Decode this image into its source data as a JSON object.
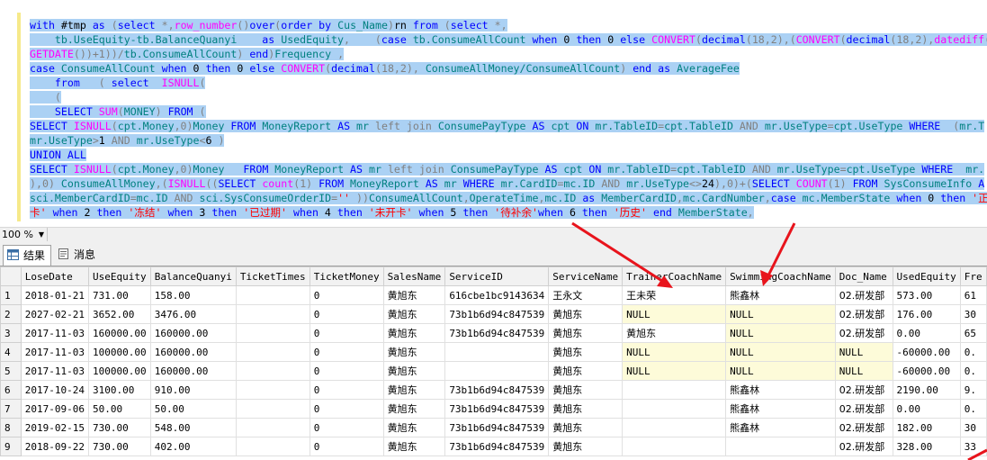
{
  "editor": {
    "lines": [
      [
        [
          "kw",
          "with "
        ],
        [
          "tx",
          "#tmp "
        ],
        [
          "kw",
          "as "
        ],
        [
          "gr",
          "("
        ],
        [
          "kw",
          "select "
        ],
        [
          "gr",
          "*,"
        ],
        [
          "fn",
          "row_number"
        ],
        [
          "gr",
          "()"
        ],
        [
          "kw",
          "over"
        ],
        [
          "gr",
          "("
        ],
        [
          "kw",
          "order by "
        ],
        [
          "tl",
          "Cus_Name"
        ],
        [
          "gr",
          ")"
        ],
        [
          "tx",
          "rn "
        ],
        [
          "kw",
          "from "
        ],
        [
          "gr",
          "("
        ],
        [
          "kw",
          "select "
        ],
        [
          "gr",
          "*,"
        ]
      ],
      [
        [
          "tx",
          "    "
        ],
        [
          "tl",
          "tb.UseEquity-tb.BalanceQuanyi    "
        ],
        [
          "kw",
          "as "
        ],
        [
          "tl",
          "UsedEquity"
        ],
        [
          "gr",
          ",    ("
        ],
        [
          "kw",
          "case "
        ],
        [
          "tl",
          "tb.ConsumeAllCount "
        ],
        [
          "kw",
          "when "
        ],
        [
          "tx",
          "0 "
        ],
        [
          "kw",
          "then "
        ],
        [
          "tx",
          "0 "
        ],
        [
          "kw",
          "else "
        ],
        [
          "fn",
          "CONVERT"
        ],
        [
          "gr",
          "("
        ],
        [
          "kw",
          "decimal"
        ],
        [
          "gr",
          "(18,2),("
        ],
        [
          "fn",
          "CONVERT"
        ],
        [
          "gr",
          "("
        ],
        [
          "kw",
          "decimal"
        ],
        [
          "gr",
          "(18,2),"
        ],
        [
          "fn",
          "datediff"
        ],
        [
          "gr",
          "(d"
        ]
      ],
      [
        [
          "fn",
          "GETDATE"
        ],
        [
          "gr",
          "())+1))/"
        ],
        [
          "tl",
          "tb.ConsumeAllCount"
        ],
        [
          "gr",
          ") "
        ],
        [
          "kw",
          "end"
        ],
        [
          "gr",
          ")"
        ],
        [
          "tl",
          "Frequency "
        ],
        [
          "gr",
          ","
        ]
      ],
      [
        [
          "kw",
          "case "
        ],
        [
          "tl",
          "ConsumeAllCount "
        ],
        [
          "kw",
          "when "
        ],
        [
          "tx",
          "0 "
        ],
        [
          "kw",
          "then "
        ],
        [
          "tx",
          "0 "
        ],
        [
          "kw",
          "else "
        ],
        [
          "fn",
          "CONVERT"
        ],
        [
          "gr",
          "("
        ],
        [
          "kw",
          "decimal"
        ],
        [
          "gr",
          "(18,2), "
        ],
        [
          "tl",
          "ConsumeAllMoney/ConsumeAllCount"
        ],
        [
          "gr",
          ") "
        ],
        [
          "kw",
          "end "
        ],
        [
          "kw",
          "as "
        ],
        [
          "tl",
          "AverageFee"
        ]
      ],
      [
        [
          "tx",
          "    "
        ],
        [
          "kw",
          "from   "
        ],
        [
          "gr",
          "( "
        ],
        [
          "kw",
          "select  "
        ],
        [
          "fn",
          "ISNULL"
        ],
        [
          "gr",
          "("
        ]
      ],
      [
        [
          "tx",
          "    "
        ],
        [
          "gr",
          "("
        ]
      ],
      [
        [
          "tx",
          "    "
        ],
        [
          "kw",
          "SELECT "
        ],
        [
          "fn",
          "SUM"
        ],
        [
          "gr",
          "("
        ],
        [
          "tl",
          "MONEY"
        ],
        [
          "gr",
          ") "
        ],
        [
          "kw",
          "FROM "
        ],
        [
          "gr",
          "("
        ]
      ],
      [
        [
          "kw",
          "SELECT "
        ],
        [
          "fn",
          "ISNULL"
        ],
        [
          "gr",
          "("
        ],
        [
          "tl",
          "cpt.Money"
        ],
        [
          "gr",
          ",0)"
        ],
        [
          "tl",
          "Money "
        ],
        [
          "kw",
          "FROM "
        ],
        [
          "tl",
          "MoneyReport "
        ],
        [
          "kw",
          "AS "
        ],
        [
          "tl",
          "mr "
        ],
        [
          "gr",
          "left join "
        ],
        [
          "tl",
          "ConsumePayType "
        ],
        [
          "kw",
          "AS "
        ],
        [
          "tl",
          "cpt "
        ],
        [
          "kw",
          "ON "
        ],
        [
          "tl",
          "mr.TableID"
        ],
        [
          "gr",
          "="
        ],
        [
          "tl",
          "cpt.TableID "
        ],
        [
          "gr",
          "AND "
        ],
        [
          "tl",
          "mr.UseType"
        ],
        [
          "gr",
          "="
        ],
        [
          "tl",
          "cpt.UseType "
        ],
        [
          "kw",
          "WHERE  "
        ],
        [
          "gr",
          "("
        ],
        [
          "tl",
          "mr.T"
        ]
      ],
      [
        [
          "tl",
          "mr.UseType"
        ],
        [
          "gr",
          ">"
        ],
        [
          "tx",
          "1 "
        ],
        [
          "gr",
          "AND "
        ],
        [
          "tl",
          "mr.UseType"
        ],
        [
          "gr",
          "<"
        ],
        [
          "tx",
          "6 "
        ],
        [
          "gr",
          ")"
        ]
      ],
      [
        [
          "kw",
          "UNION ALL"
        ]
      ],
      [
        [
          "kw",
          "SELECT "
        ],
        [
          "fn",
          "ISNULL"
        ],
        [
          "gr",
          "("
        ],
        [
          "tl",
          "cpt.Money"
        ],
        [
          "gr",
          ",0)"
        ],
        [
          "tl",
          "Money   "
        ],
        [
          "kw",
          "FROM "
        ],
        [
          "tl",
          "MoneyReport "
        ],
        [
          "kw",
          "AS "
        ],
        [
          "tl",
          "mr "
        ],
        [
          "gr",
          "left join "
        ],
        [
          "tl",
          "ConsumePayType "
        ],
        [
          "kw",
          "AS "
        ],
        [
          "tl",
          "cpt "
        ],
        [
          "kw",
          "ON "
        ],
        [
          "tl",
          "mr.TableID"
        ],
        [
          "gr",
          "="
        ],
        [
          "tl",
          "cpt.TableID "
        ],
        [
          "gr",
          "AND "
        ],
        [
          "tl",
          "mr.UseType"
        ],
        [
          "gr",
          "="
        ],
        [
          "tl",
          "cpt.UseType "
        ],
        [
          "kw",
          "WHERE  "
        ],
        [
          "tl",
          "mr."
        ]
      ],
      [
        [
          "gr",
          "),0) "
        ],
        [
          "tl",
          "ConsumeAllMoney"
        ],
        [
          "gr",
          ",("
        ],
        [
          "fn",
          "ISNULL"
        ],
        [
          "gr",
          "(("
        ],
        [
          "kw",
          "SELECT "
        ],
        [
          "fn",
          "count"
        ],
        [
          "gr",
          "(1) "
        ],
        [
          "kw",
          "FROM "
        ],
        [
          "tl",
          "MoneyReport "
        ],
        [
          "kw",
          "AS "
        ],
        [
          "tl",
          "mr "
        ],
        [
          "kw",
          "WHERE "
        ],
        [
          "tl",
          "mr.CardID"
        ],
        [
          "gr",
          "="
        ],
        [
          "tl",
          "mc.ID "
        ],
        [
          "gr",
          "AND "
        ],
        [
          "tl",
          "mr.UseType"
        ],
        [
          "gr",
          "<>"
        ],
        [
          "tx",
          "24"
        ],
        [
          "gr",
          "),0)+("
        ],
        [
          "kw",
          "SELECT "
        ],
        [
          "fn",
          "COUNT"
        ],
        [
          "gr",
          "(1) "
        ],
        [
          "kw",
          "FROM "
        ],
        [
          "tl",
          "SysConsumeInfo "
        ],
        [
          "kw",
          "A"
        ]
      ],
      [
        [
          "tl",
          "sci.MemberCardID"
        ],
        [
          "gr",
          "="
        ],
        [
          "tl",
          "mc.ID "
        ],
        [
          "gr",
          "AND "
        ],
        [
          "tl",
          "sci.SysConsumeOrderID"
        ],
        [
          "gr",
          "="
        ],
        [
          "st",
          "'' "
        ],
        [
          "gr",
          "))"
        ],
        [
          "tl",
          "ConsumeAllCount"
        ],
        [
          "gr",
          ","
        ],
        [
          "tl",
          "OperateTime"
        ],
        [
          "gr",
          ","
        ],
        [
          "tl",
          "mc.ID "
        ],
        [
          "kw",
          "as "
        ],
        [
          "tl",
          "MemberCardID"
        ],
        [
          "gr",
          ","
        ],
        [
          "tl",
          "mc.CardNumber"
        ],
        [
          "gr",
          ","
        ],
        [
          "kw",
          "case "
        ],
        [
          "tl",
          "mc.MemberState "
        ],
        [
          "kw",
          "when "
        ],
        [
          "tx",
          "0 "
        ],
        [
          "kw",
          "then "
        ],
        [
          "st",
          "'正"
        ]
      ],
      [
        [
          "st",
          "卡' "
        ],
        [
          "kw",
          "when "
        ],
        [
          "tx",
          "2 "
        ],
        [
          "kw",
          "then "
        ],
        [
          "st",
          "'冻结' "
        ],
        [
          "kw",
          "when "
        ],
        [
          "tx",
          "3 "
        ],
        [
          "kw",
          "then "
        ],
        [
          "st",
          "'已过期' "
        ],
        [
          "kw",
          "when "
        ],
        [
          "tx",
          "4 "
        ],
        [
          "kw",
          "then "
        ],
        [
          "st",
          "'未开卡' "
        ],
        [
          "kw",
          "when "
        ],
        [
          "tx",
          "5 "
        ],
        [
          "kw",
          "then "
        ],
        [
          "st",
          "'待补余'"
        ],
        [
          "kw",
          "when "
        ],
        [
          "tx",
          "6 "
        ],
        [
          "kw",
          "then "
        ],
        [
          "st",
          "'历史' "
        ],
        [
          "kw",
          "end "
        ],
        [
          "tl",
          "MemberState"
        ],
        [
          "gr",
          ","
        ]
      ]
    ]
  },
  "zoom": {
    "value": "100 %"
  },
  "tabs": [
    {
      "label": "结果",
      "icon": "grid-results-icon"
    },
    {
      "label": "消息",
      "icon": "message-icon"
    }
  ],
  "grid": {
    "columns": [
      "",
      "LoseDate",
      "UseEquity",
      "BalanceQuanyi",
      "TicketTimes",
      "TicketMoney",
      "SalesName",
      "ServiceID",
      "ServiceName",
      "TrainerCoachName",
      "SwimmingCoachName",
      "Doc_Name",
      "UsedEquity",
      "Fre"
    ],
    "rows": [
      [
        "1",
        "2018-01-21",
        "731.00",
        "158.00",
        "",
        "0",
        "黄旭东",
        "616cbe1bc9143634",
        "王永文",
        "王未荣",
        "熊鑫林",
        "02.研发部",
        "573.00",
        "61"
      ],
      [
        "2",
        "2027-02-21",
        "3652.00",
        "3476.00",
        "",
        "0",
        "黄旭东",
        "73b1b6d94c847539",
        "黄旭东",
        "NULL",
        "NULL",
        "02.研发部",
        "176.00",
        "30"
      ],
      [
        "3",
        "2017-11-03",
        "160000.00",
        "160000.00",
        "",
        "0",
        "黄旭东",
        "73b1b6d94c847539",
        "黄旭东",
        "黄旭东",
        "NULL",
        "02.研发部",
        "0.00",
        "65"
      ],
      [
        "4",
        "2017-11-03",
        "100000.00",
        "160000.00",
        "",
        "0",
        "黄旭东",
        "",
        "黄旭东",
        "NULL",
        "NULL",
        "NULL",
        "-60000.00",
        "0."
      ],
      [
        "5",
        "2017-11-03",
        "100000.00",
        "160000.00",
        "",
        "0",
        "黄旭东",
        "",
        "黄旭东",
        "NULL",
        "NULL",
        "NULL",
        "-60000.00",
        "0."
      ],
      [
        "6",
        "2017-10-24",
        "3100.00",
        "910.00",
        "",
        "0",
        "黄旭东",
        "73b1b6d94c847539",
        "黄旭东",
        "",
        "熊鑫林",
        "02.研发部",
        "2190.00",
        "9."
      ],
      [
        "7",
        "2017-09-06",
        "50.00",
        "50.00",
        "",
        "0",
        "黄旭东",
        "73b1b6d94c847539",
        "黄旭东",
        "",
        "熊鑫林",
        "02.研发部",
        "0.00",
        "0."
      ],
      [
        "8",
        "2019-02-15",
        "730.00",
        "548.00",
        "",
        "0",
        "黄旭东",
        "73b1b6d94c847539",
        "黄旭东",
        "",
        "熊鑫林",
        "02.研发部",
        "182.00",
        "30"
      ],
      [
        "9",
        "2018-09-22",
        "730.00",
        "402.00",
        "",
        "0",
        "黄旭东",
        "73b1b6d94c847539",
        "黄旭东",
        "",
        "",
        "02.研发部",
        "328.00",
        "33"
      ]
    ]
  },
  "annotation_color": "#e8141c"
}
